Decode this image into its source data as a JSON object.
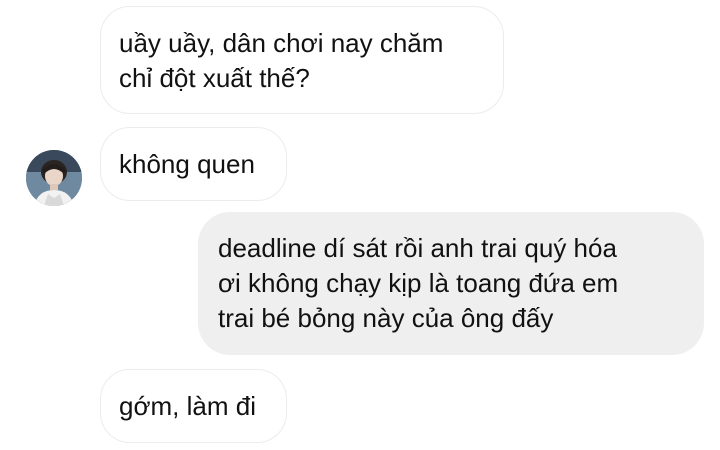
{
  "conversation": {
    "messages": [
      {
        "direction": "incoming",
        "lines": [
          "uầy uầy, dân chơi nay chăm",
          "chỉ đột xuất thế?"
        ]
      },
      {
        "direction": "incoming",
        "lines": [
          "không quen"
        ],
        "avatar_icon": "contact-avatar-photo"
      },
      {
        "direction": "outgoing",
        "lines": [
          "deadline dí sát rồi anh trai quý hóa",
          "ơi không chạy kịp là toang đứa em",
          "trai bé bỏng này của ông đấy"
        ]
      },
      {
        "direction": "incoming",
        "lines": [
          "gớm, làm đi"
        ]
      }
    ]
  },
  "colors": {
    "incoming_bubble": "#ffffff",
    "incoming_border": "#ececec",
    "outgoing_bubble": "#efefef",
    "text": "#111111",
    "background": "#ffffff"
  }
}
